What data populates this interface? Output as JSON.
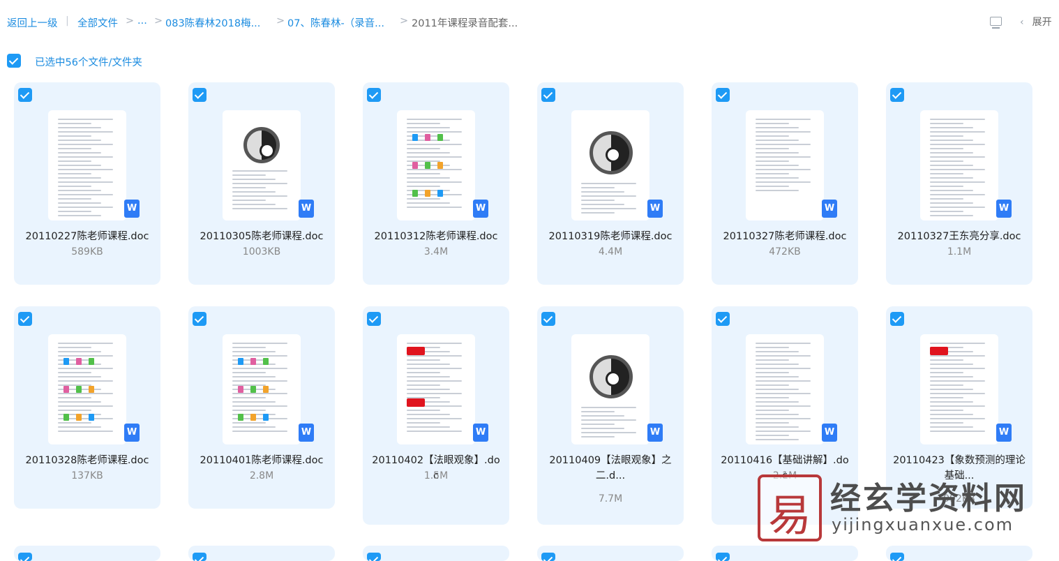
{
  "breadcrumb": {
    "back": "返回上一级",
    "separator": "|",
    "all_files": "全部文件",
    "ellipsis": "...",
    "folder1": "083陈春林2018梅...",
    "folder2": "07、陈春林-（录音...",
    "current": "2011年课程录音配套..."
  },
  "toolbar": {
    "view_toggle_icon": "monitor-icon",
    "expand_label": "展开",
    "chevron": "‹"
  },
  "selection": {
    "label": "已选中56个文件/文件夹",
    "checked": true
  },
  "files": [
    {
      "name": "20110227陈老师课程.doc",
      "size": "589KB",
      "checked": true,
      "thumb": "text"
    },
    {
      "name": "20110305陈老师课程.doc",
      "size": "1003KB",
      "checked": true,
      "thumb": "bagua-small"
    },
    {
      "name": "20110312陈老师课程.doc",
      "size": "3.4M",
      "checked": true,
      "thumb": "hexagram"
    },
    {
      "name": "20110319陈老师课程.doc",
      "size": "4.4M",
      "checked": true,
      "thumb": "bagua"
    },
    {
      "name": "20110327陈老师课程.doc",
      "size": "472KB",
      "checked": true,
      "thumb": "text-bold"
    },
    {
      "name": "20110327王东亮分享.doc",
      "size": "1.1M",
      "checked": true,
      "thumb": "text"
    },
    {
      "name": "20110328陈老师课程.doc",
      "size": "137KB",
      "checked": true,
      "thumb": "hexagram"
    },
    {
      "name": "20110401陈老师课程.doc",
      "size": "2.8M",
      "checked": true,
      "thumb": "colored-hexagram"
    },
    {
      "name": "20110402【法眼观象】.doc",
      "size": "1.5M",
      "checked": true,
      "thumb": "red-tags"
    },
    {
      "name": "20110409【法眼观象】之二.d...",
      "size": "7.7M",
      "checked": true,
      "thumb": "bagua-table"
    },
    {
      "name": "20110416【基础讲解】.doc",
      "size": "2.1M",
      "checked": true,
      "thumb": "text"
    },
    {
      "name": "20110423【象数预测的理论基础...",
      "size": "992KB",
      "checked": true,
      "thumb": "red-tag"
    }
  ],
  "file_icon": {
    "name": "word-doc-icon",
    "glyph": "W",
    "color": "#2f7cf6"
  },
  "watermark": {
    "logo_glyph": "易",
    "title": "经玄学资料网",
    "url": "yijingxuanxue.com"
  },
  "colors": {
    "accent": "#1e9af5",
    "card_bg": "#eaf4fe",
    "link": "#1c8ce0"
  }
}
